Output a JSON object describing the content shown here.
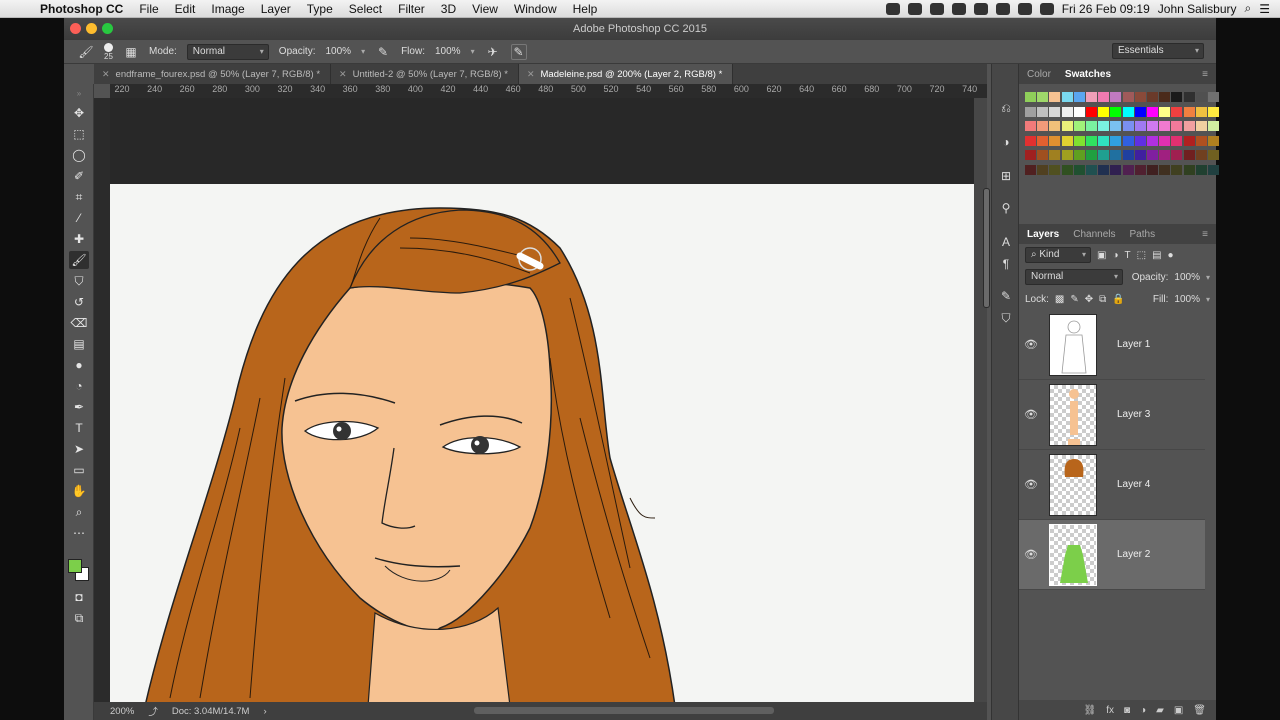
{
  "menubar": {
    "app_name": "Photoshop CC",
    "menus": [
      "File",
      "Edit",
      "Image",
      "Layer",
      "Type",
      "Select",
      "Filter",
      "3D",
      "View",
      "Window",
      "Help"
    ],
    "clock": "Fri 26 Feb 09:19",
    "user": "John Salisbury"
  },
  "window": {
    "title": "Adobe Photoshop CC 2015"
  },
  "options": {
    "brush_size": "25",
    "mode_label": "Mode:",
    "mode_value": "Normal",
    "opacity_label": "Opacity:",
    "opacity_value": "100%",
    "flow_label": "Flow:",
    "flow_value": "100%",
    "workspace": "Essentials"
  },
  "tabs": [
    {
      "label": "endframe_fourex.psd @ 50% (Layer 7, RGB/8) *",
      "active": false
    },
    {
      "label": "Untitled-2 @ 50% (Layer 7, RGB/8) *",
      "active": false
    },
    {
      "label": "Madeleine.psd @ 200% (Layer 2, RGB/8) *",
      "active": true
    }
  ],
  "ruler_ticks": [
    "220",
    "240",
    "260",
    "280",
    "300",
    "320",
    "340",
    "360",
    "380",
    "400",
    "420",
    "440",
    "460",
    "480",
    "500",
    "520",
    "540",
    "560",
    "580",
    "600",
    "620",
    "640",
    "660",
    "680",
    "700",
    "720",
    "740"
  ],
  "status": {
    "zoom": "200%",
    "doc": "Doc: 3.04M/14.7M"
  },
  "panels": {
    "color_tabs": [
      "Color",
      "Swatches"
    ],
    "layers_tabs": [
      "Layers",
      "Channels",
      "Paths"
    ],
    "filter_kind": "Kind",
    "blend_mode": "Normal",
    "opacity_label": "Opacity:",
    "opacity_value": "100%",
    "lock_label": "Lock:",
    "fill_label": "Fill:",
    "fill_value": "100%"
  },
  "layers": [
    {
      "name": "Layer 1",
      "selected": false
    },
    {
      "name": "Layer 3",
      "selected": false
    },
    {
      "name": "Layer 4",
      "selected": false
    },
    {
      "name": "Layer 2",
      "selected": true
    }
  ],
  "colors": {
    "foreground": "#7ccf4a",
    "background": "#ffffff",
    "hair": "#b8651b",
    "skin": "#f6c292"
  }
}
